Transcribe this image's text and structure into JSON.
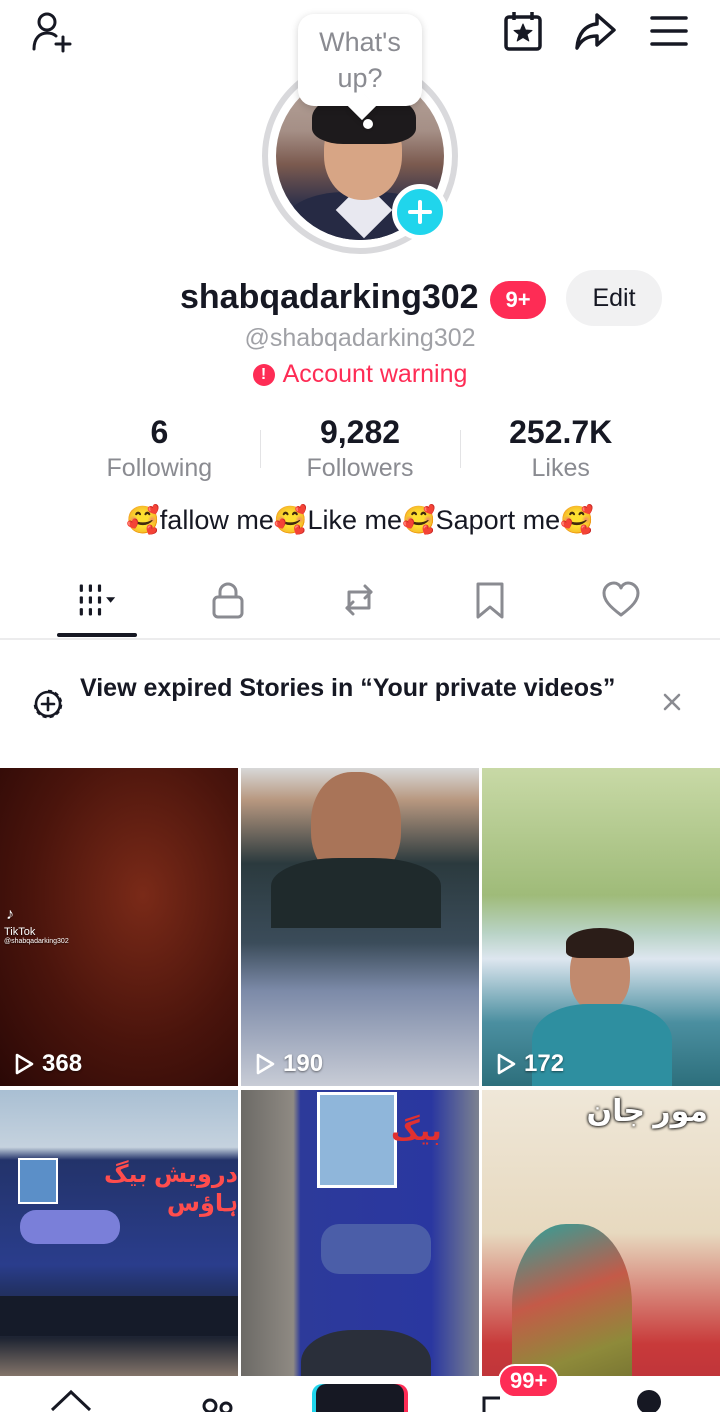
{
  "topbar": {
    "icons": [
      "add-friend-icon",
      "calendar-star-icon",
      "share-icon",
      "menu-icon"
    ]
  },
  "profile": {
    "bubble_text": "What's\nup?",
    "username": "shabqadarking302",
    "username_badge": "9+",
    "edit_label": "Edit",
    "handle": "@shabqadarking302",
    "warning_text": "Account warning",
    "bio": "🥰fallow me🥰Like me🥰Saport me🥰"
  },
  "stats": [
    {
      "value": "6",
      "label": "Following"
    },
    {
      "value": "9,282",
      "label": "Followers"
    },
    {
      "value": "252.7K",
      "label": "Likes"
    }
  ],
  "tabs": [
    "videos-grid-icon",
    "lock-icon",
    "repost-icon",
    "bookmark-icon",
    "heart-icon"
  ],
  "story_banner": {
    "text": "View expired Stories in “Your private videos”"
  },
  "videos": [
    {
      "views": "368"
    },
    {
      "views": "190"
    },
    {
      "views": "172"
    },
    {
      "views": ""
    },
    {
      "views": ""
    },
    {
      "views": ""
    }
  ],
  "video_overlays": {
    "tiktok_label": "TikTok",
    "tiktok_handle": "@shabqadarking302",
    "urdu_title": "مور جان"
  },
  "bottom_nav": {
    "inbox_badge": "99+"
  },
  "colors": {
    "accent_red": "#fe2c55",
    "accent_cyan": "#20d5ec",
    "text_primary": "#161823",
    "text_secondary": "#8a8b91"
  }
}
